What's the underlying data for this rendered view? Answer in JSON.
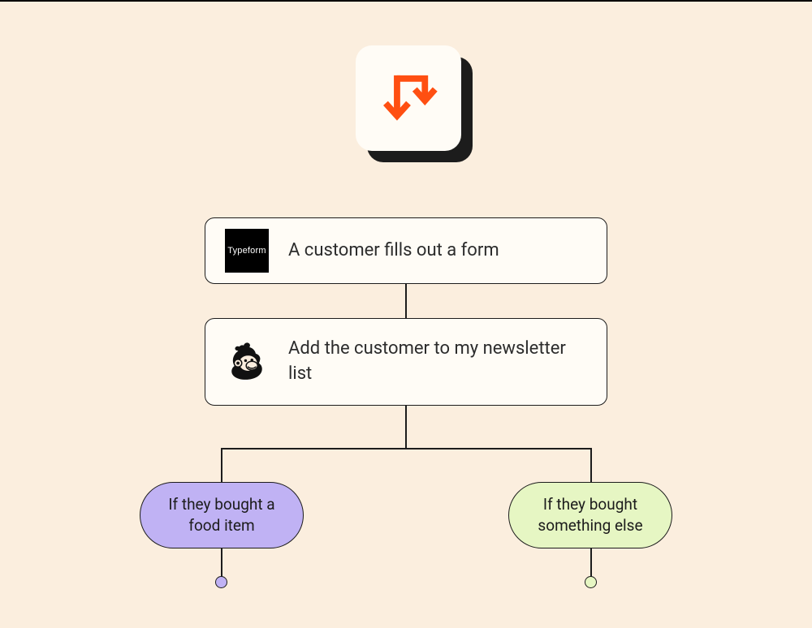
{
  "top_icon": "branch-arrows-icon",
  "steps": [
    {
      "service": "Typeform",
      "service_label": "Typeform",
      "text": "A customer fills out a form"
    },
    {
      "service": "Mailchimp",
      "text": "Add the customer to my newsletter list"
    }
  ],
  "branches": [
    {
      "label": "If they bought a food item",
      "color": "#c0b2f4"
    },
    {
      "label": "If they bought something else",
      "color": "#e6f6c3"
    }
  ]
}
